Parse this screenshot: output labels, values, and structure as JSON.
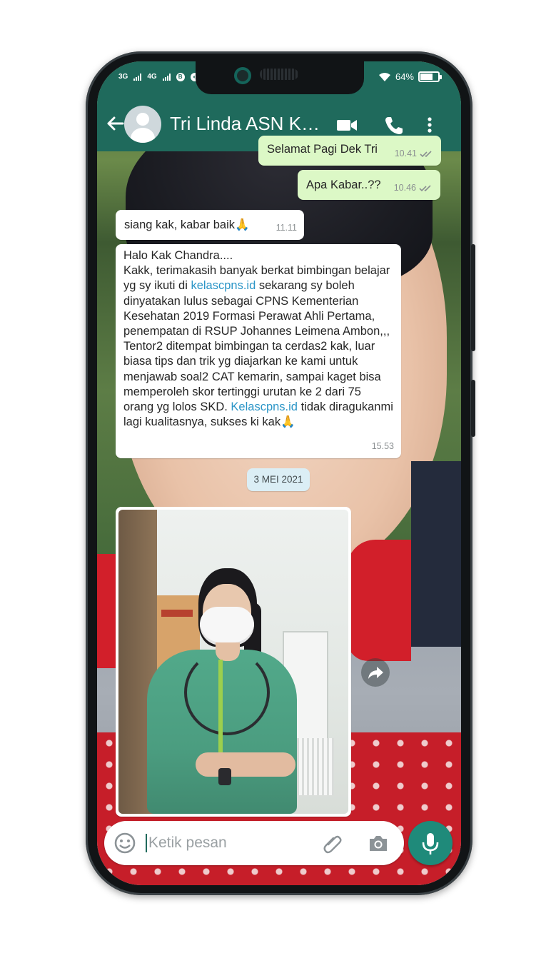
{
  "status_bar": {
    "network_1": "3G",
    "network_2": "4G",
    "battery_text": "64%",
    "battery_level": 0.64,
    "icons": [
      "signal-icon",
      "b-icon",
      "leaf-icon",
      "wifi-icon",
      "battery-icon"
    ]
  },
  "header": {
    "title": "Tri Linda ASN Ke...",
    "icons": [
      "back-arrow-icon",
      "avatar-icon",
      "video-call-icon",
      "phone-call-icon",
      "more-vert-icon"
    ]
  },
  "messages": [
    {
      "side": "out",
      "text": "Selamat Pagi Dek Tri",
      "time": "10.41",
      "status": "read"
    },
    {
      "side": "out",
      "text": "Apa Kabar..??",
      "time": "10.46",
      "status": "read"
    },
    {
      "side": "in",
      "text": "siang kak, kabar baik🙏",
      "time": "11.11"
    },
    {
      "side": "in",
      "greeting": "Halo Kak Chandra....",
      "part1": "Kakk, terimakasih banyak berkat bimbingan belajar yg sy ikuti di ",
      "link1": "kelascpns.id",
      "part2": " sekarang sy boleh dinyatakan lulus sebagai CPNS Kementerian Kesehatan 2019 Formasi Perawat Ahli Pertama, penempatan di RSUP Johannes Leimena Ambon,,, Tentor2 ditempat bimbingan ta cerdas2 kak, luar biasa tips dan trik yg diajarkan ke kami untuk menjawab soal2 CAT kemarin, sampai kaget bisa memperoleh skor tertinggi urutan ke 2 dari 75 orang yg lolos SKD. ",
      "link2": "Kelascpns.id",
      "part3": " tidak diragukanmi lagi kualitasnya, sukses ki kak🙏",
      "time": "15.53"
    }
  ],
  "date_divider": "3 MEI 2021",
  "photo_message": {
    "icon": "forward-icon"
  },
  "input_bar": {
    "placeholder": "Ketik pesan",
    "icons": [
      "emoji-icon",
      "attach-icon",
      "camera-icon",
      "mic-icon"
    ]
  },
  "colors": {
    "header": "#1f6a5c",
    "outgoing_bubble": "#dcf8c6",
    "incoming_bubble": "#ffffff",
    "link": "#2b95c7",
    "mic_button": "#1f8a7a"
  }
}
